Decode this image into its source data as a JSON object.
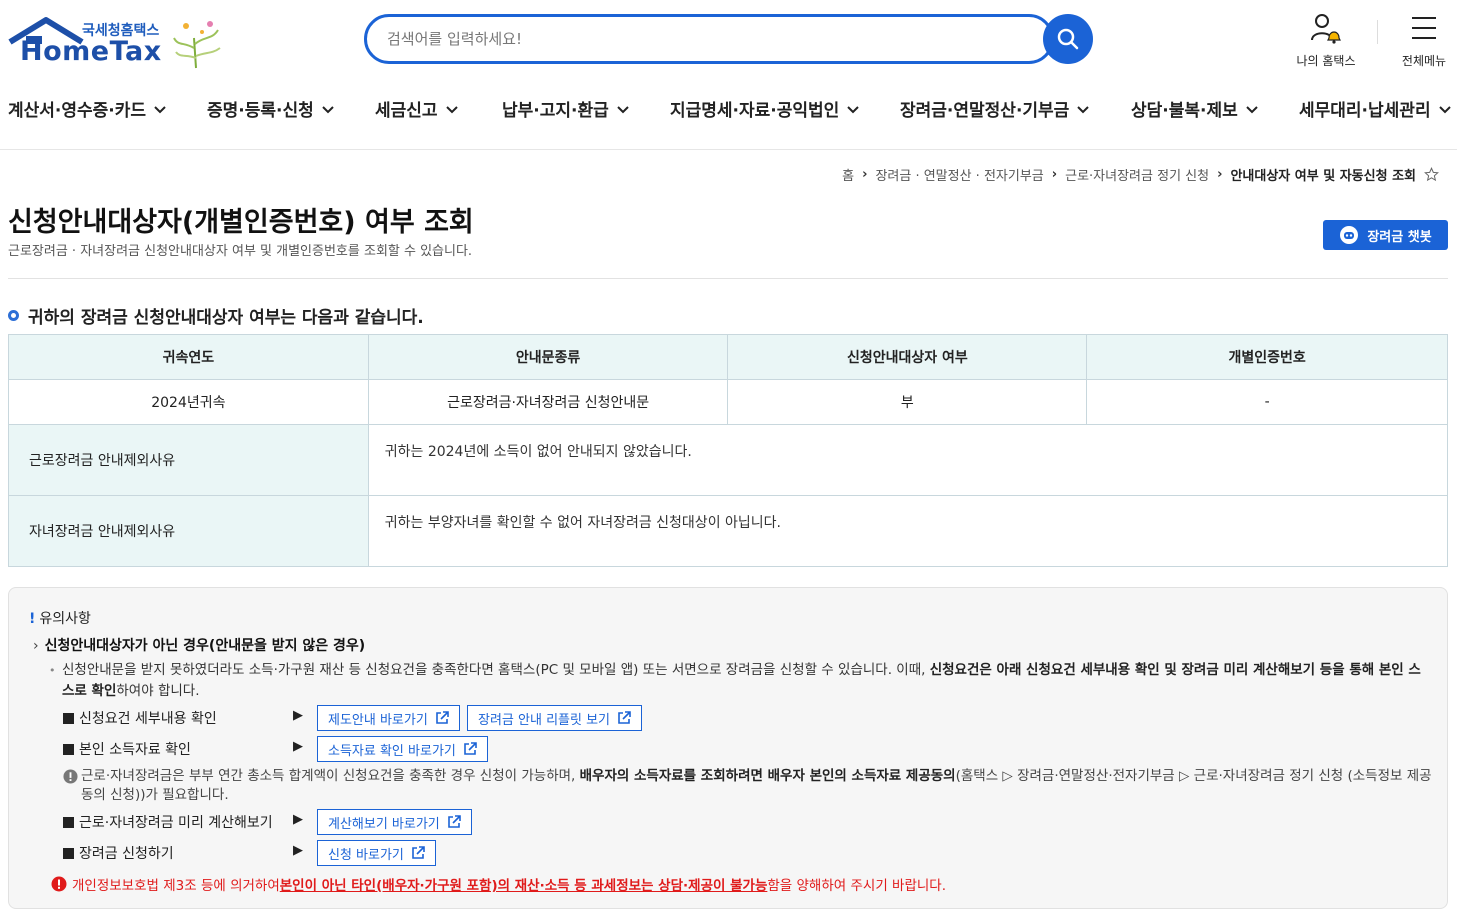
{
  "header": {
    "logo_kr": "국세청홈택스",
    "logo_en": "HomeTax",
    "search_placeholder": "검색어를 입력하세요!",
    "my_hometax": "나의 홈택스",
    "all_menu": "전체메뉴"
  },
  "gnb": [
    {
      "label": "계산서·영수증·카드"
    },
    {
      "label": "증명·등록·신청"
    },
    {
      "label": "세금신고"
    },
    {
      "label": "납부·고지·환급"
    },
    {
      "label": "지급명세·자료·공익법인"
    },
    {
      "label": "장려금·연말정산·기부금"
    },
    {
      "label": "상담·불복·제보"
    },
    {
      "label": "세무대리·납세관리"
    }
  ],
  "breadcrumb": {
    "home": "홈",
    "level1": "장려금 · 연말정산 · 전자기부금",
    "level2": "근로·자녀장려금 정기 신청",
    "current": "안내대상자 여부 및 자동신청 조회"
  },
  "page": {
    "title": "신청안내대상자(개별인증번호) 여부 조회",
    "description": "근로장려금 · 자녀장려금 신청안내대상자 여부 및 개별인증번호를 조회할 수 있습니다.",
    "chatbot": "장려금 챗봇",
    "section_heading": "귀하의 장려금 신청안내대상자 여부는 다음과 같습니다."
  },
  "table": {
    "headers": [
      "귀속연도",
      "안내문종류",
      "신청안내대상자 여부",
      "개별인증번호"
    ],
    "row": [
      "2024년귀속",
      "근로장려금·자녀장려금 신청안내문",
      "부",
      "-"
    ],
    "reasons": [
      {
        "label": "근로장려금 안내제외사유",
        "text": "귀하는 2024년에 소득이 없어 안내되지 않았습니다."
      },
      {
        "label": "자녀장려금 안내제외사유",
        "text": "귀하는 부양자녀를 확인할 수 없어 자녀장려금 신청대상이 아닙니다."
      }
    ]
  },
  "notice": {
    "title": "유의사항",
    "subtitle": "신청안내대상자가 아닌 경우(안내문을 받지 않은 경우)",
    "body_plain": "신청안내문을 받지 못하였더라도 소득·가구원 재산 등 신청요건을 충족한다면 홈택스(PC 및 모바일 앱) 또는 서면으로 장려금을 신청할 수 있습니다. 이때, ",
    "body_bold1": "신청요건은 아래 신청요건 세부내용 확인 및 장려금 미리 계산해보기 등을 통해 본인 스스로 확인",
    "body_tail": "하여야 합니다.",
    "items": [
      {
        "label": "신청요건 세부내용 확인",
        "buttons": [
          "제도안내 바로가기",
          "장려금 안내 리플릿 보기"
        ]
      },
      {
        "label": "본인 소득자료 확인",
        "buttons": [
          "소득자료 확인 바로가기"
        ]
      },
      {
        "label": "근로·자녀장려금 미리 계산해보기",
        "buttons": [
          "계산해보기 바로가기"
        ]
      },
      {
        "label": "장려금 신청하기",
        "buttons": [
          "신청 바로가기"
        ]
      }
    ],
    "info_plain": "근로·자녀장려금은 부부 연간 총소득 합계액이 신청요건을 충족한 경우 신청이 가능하며, ",
    "info_bold": "배우자의 소득자료를 조회하려면 배우자 본인의 소득자료 제공동의",
    "info_tail": "(홈택스 ▷ 장려금·연말정산·전자기부금 ▷ 근로·자녀장려금 정기 신청 (소득정보 제공동의 신청))가 필요합니다.",
    "warn_plain": "개인정보보호법 제3조 등에 의거하여 ",
    "warn_bold": "본인이 아닌 타인(배우자·가구원 포함)의 재산·소득 등 과세정보는 상담·제공이 불가능",
    "warn_tail": "함을 양해하여 주시기 바랍니다."
  },
  "colors": {
    "primary": "#1b63d6",
    "table_head_bg": "#eaf6f6",
    "warning": "#e01b1b"
  }
}
